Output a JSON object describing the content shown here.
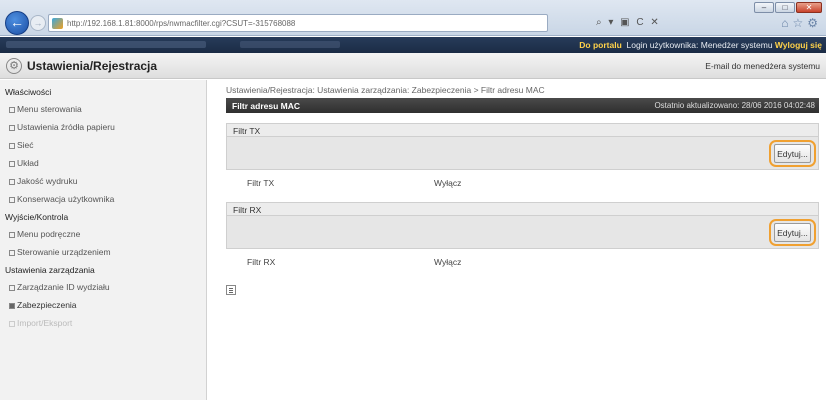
{
  "browser": {
    "url": "http://192.168.1.81:8000/rps/nwmacfilter.cgi?CSUT=-315768088",
    "tools": "⌕ ▾ ▣ C ✕",
    "window_buttons": [
      "–",
      "□",
      "✕"
    ]
  },
  "topbar": {
    "portal_link": "Do portalu",
    "login_label": "Login użytkownika:",
    "login_user": "Menedżer systemu",
    "logout": "Wyloguj się"
  },
  "header": {
    "title": "Ustawienia/Rejestracja",
    "email_link": "E-mail do menedżera systemu"
  },
  "sidebar": {
    "sections": [
      {
        "label": "Właściwości",
        "items": [
          "Menu sterowania",
          "Ustawienia źródła papieru",
          "Sieć",
          "Układ",
          "Jakość wydruku",
          "Konserwacja użytkownika"
        ]
      },
      {
        "label": "Wyjście/Kontrola",
        "items": [
          "Menu podręczne",
          "Sterowanie urządzeniem"
        ]
      },
      {
        "label": "Ustawienia zarządzania",
        "items": [
          "Zarządzanie ID wydziału",
          "Zabezpieczenia",
          "Import/Eksport"
        ]
      }
    ]
  },
  "main": {
    "breadcrumb": "Ustawienia/Rejestracja: Ustawienia zarządzania: Zabezpieczenia > Filtr adresu MAC",
    "panel_title": "Filtr adresu MAC",
    "last_updated": "Ostatnio aktualizowano: 28/06 2016 04:02:48",
    "sections": [
      {
        "title": "Filtr TX",
        "edit_label": "Edytuj...",
        "key": "Filtr TX",
        "value": "Wyłącz"
      },
      {
        "title": "Filtr RX",
        "edit_label": "Edytuj...",
        "key": "Filtr RX",
        "value": "Wyłącz"
      }
    ]
  },
  "colors": {
    "topbar": "#1f3150",
    "link_highlight": "#ffd24a",
    "panel_head": "#3a3a3a",
    "edit_callout": "#f0a030"
  }
}
